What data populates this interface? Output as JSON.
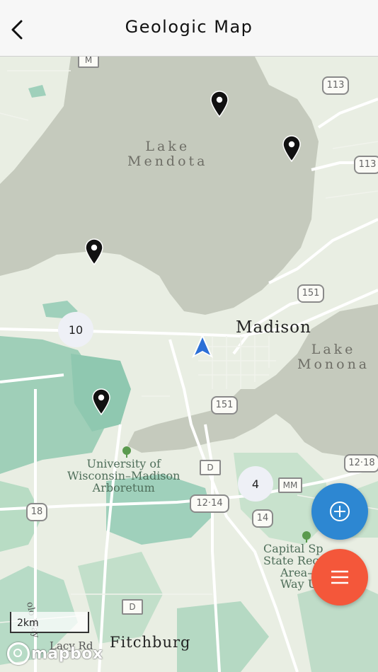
{
  "header": {
    "title": "Geologic Map",
    "back_icon": "chevron-left-icon"
  },
  "map": {
    "lakes": [
      {
        "line1": "Lake",
        "line2": "Mendota"
      },
      {
        "line1": "Lake",
        "line2": "Monona"
      }
    ],
    "city": "Madison",
    "town": "Fitchburg",
    "road_label": "Lacy Rd",
    "poi_arboretum": {
      "line1": "University of",
      "line2": "Wisconsin–Madison",
      "line3": "Arboretum"
    },
    "poi_capital": {
      "line1": "Capital Sp",
      "line2": "State Rec",
      "line3": "Area–",
      "line4": "Way Un"
    },
    "side_road": "olo Way",
    "shields": [
      "M",
      "113",
      "113",
      "151",
      "151",
      "12·18",
      "12·14",
      "14",
      "18",
      "D",
      "D",
      "MM"
    ],
    "clusters": [
      "10",
      "4"
    ],
    "scale_label": "2km",
    "attribution": "mapbox"
  },
  "buttons": {
    "add_icon": "plus-circle-icon",
    "menu_icon": "menu-icon"
  },
  "colors": {
    "add_fab": "#2d87d2",
    "menu_fab": "#f4573a",
    "user_location": "#2b6fd6"
  }
}
